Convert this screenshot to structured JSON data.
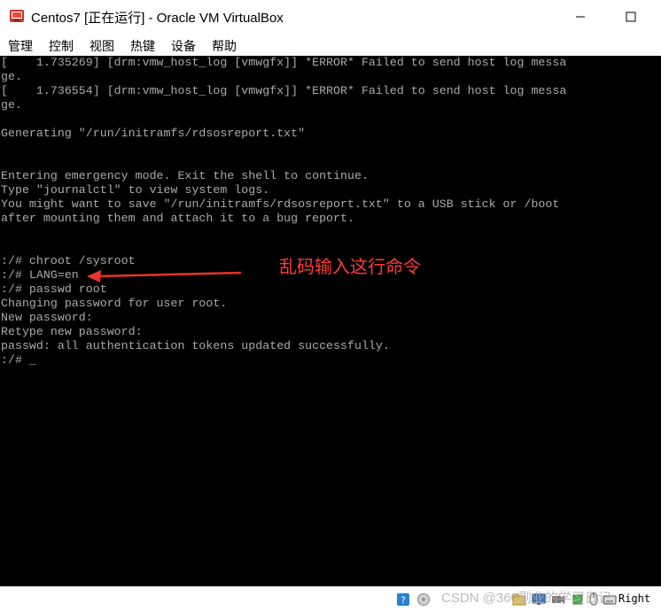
{
  "window": {
    "title": "Centos7 [正在运行] - Oracle VM VirtualBox",
    "minimize_icon": "minimize-icon",
    "maximize_icon": "maximize-icon"
  },
  "menu": {
    "items": [
      "管理",
      "控制",
      "视图",
      "热键",
      "设备",
      "帮助"
    ]
  },
  "console": {
    "lines": [
      "[    1.735269] [drm:vmw_host_log [vmwgfx]] *ERROR* Failed to send host log messa",
      "ge.",
      "[    1.736554] [drm:vmw_host_log [vmwgfx]] *ERROR* Failed to send host log messa",
      "ge.",
      "",
      "Generating \"/run/initramfs/rdsosreport.txt\"",
      "",
      "",
      "Entering emergency mode. Exit the shell to continue.",
      "Type \"journalctl\" to view system logs.",
      "You might want to save \"/run/initramfs/rdsosreport.txt\" to a USB stick or /boot",
      "after mounting them and attach it to a bug report.",
      "",
      "",
      ":/# chroot /sysroot",
      ":/# LANG=en",
      ":/# passwd root",
      "Changing password for user root.",
      "New password:",
      "Retype new password:",
      "passwd: all authentication tokens updated successfully.",
      ":/# _"
    ],
    "annotation": "乱码输入这行命令",
    "annotation_color": "#ff3b3b"
  },
  "statusbar": {
    "watermark": "CSDN @360副业的学习日记",
    "host_key": "Right",
    "icons": [
      "help-icon",
      "disk-icon",
      "optical-icon",
      "audio-icon",
      "network-icon",
      "usb-icon",
      "shared-folder-icon",
      "display-icon",
      "video-capture-icon",
      "recording-icon",
      "cpu-icon",
      "mouse-icon",
      "keyboard-icon"
    ]
  },
  "colors": {
    "console_bg": "#000000",
    "console_fg": "#aaaaaa",
    "arrow": "#e8342b"
  }
}
